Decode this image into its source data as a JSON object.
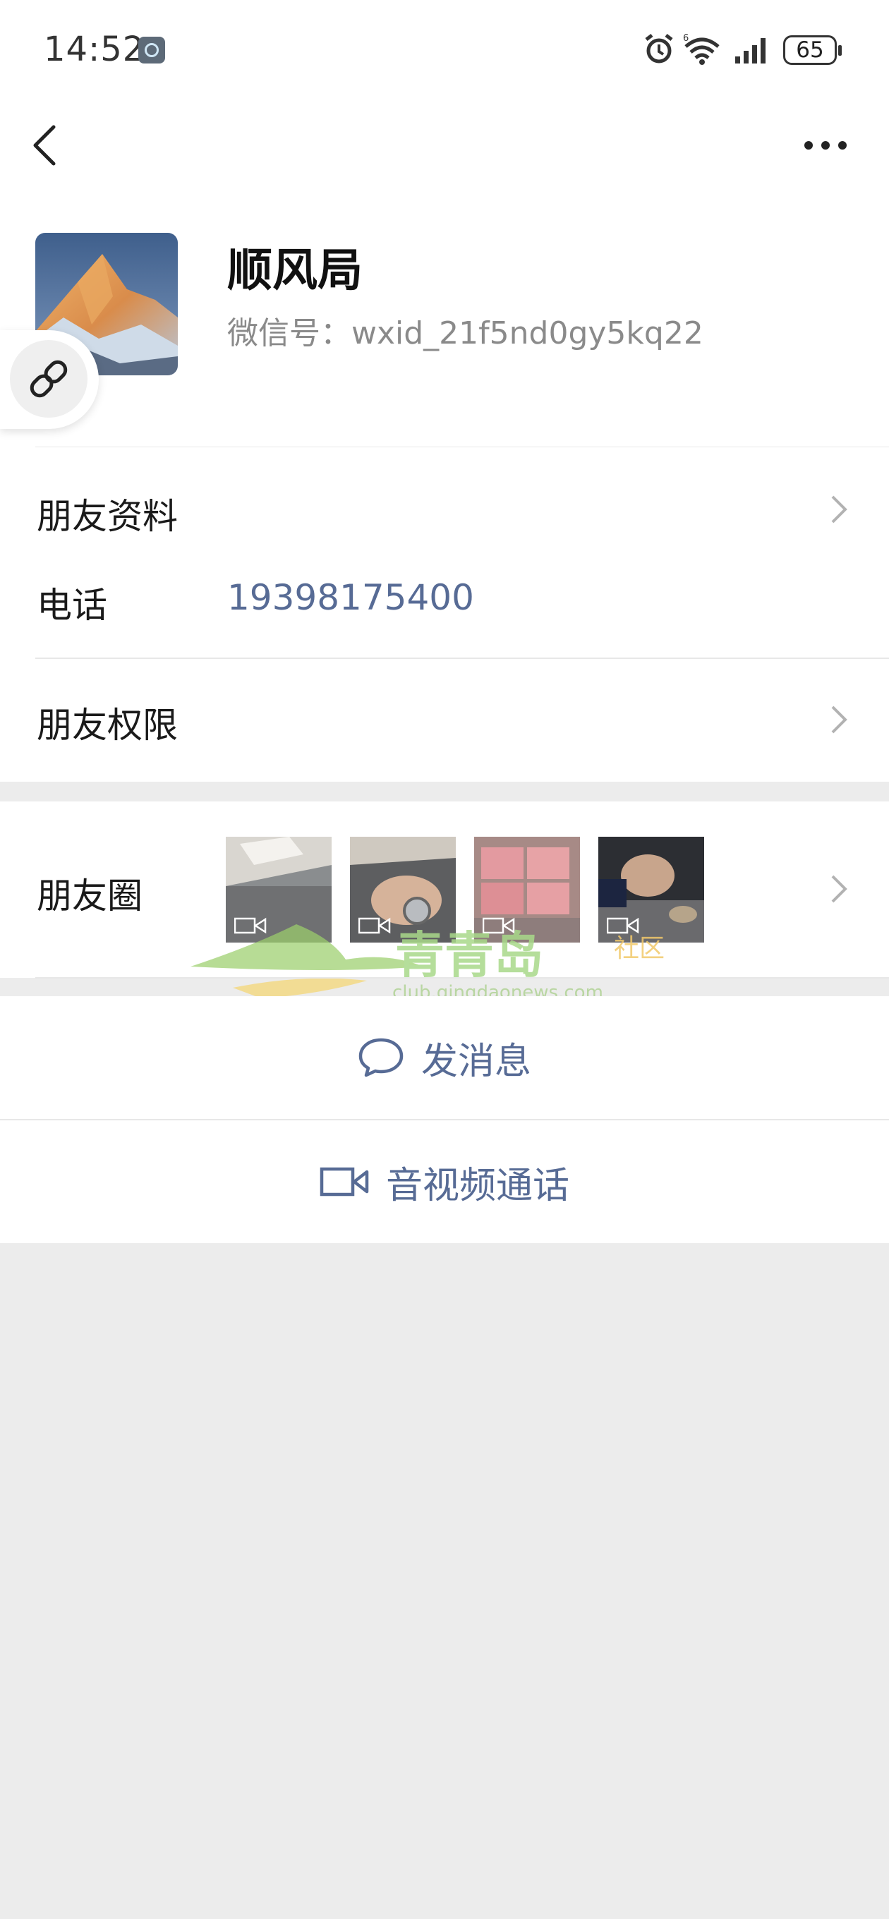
{
  "status_bar": {
    "time": "14:52",
    "battery": "65"
  },
  "profile": {
    "nickname": "顺风局",
    "wechat_id": "微信号：wxid_21f5nd0gy5kq22"
  },
  "rows": {
    "friend_info_label": "朋友资料",
    "phone_label": "电话",
    "phone_value": "19398175400",
    "permissions_label": "朋友权限",
    "moments_label": "朋友圈"
  },
  "watermark": {
    "title": "青青岛",
    "subtitle": "社区",
    "url": "club.qingdaonews.com"
  },
  "actions": {
    "send_message": "发消息",
    "video_call": "音视频通话"
  },
  "colors": {
    "link_blue": "#576b95",
    "background_gray": "#ececec"
  }
}
